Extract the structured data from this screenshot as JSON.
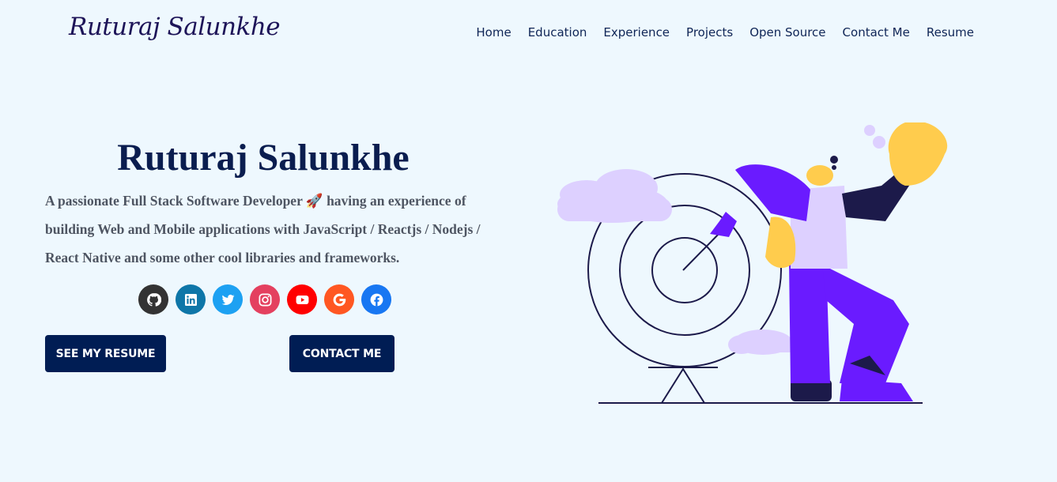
{
  "header": {
    "logo_text": "Ruturaj Salunkhe",
    "nav": [
      "Home",
      "Education",
      "Experience",
      "Projects",
      "Open Source",
      "Contact Me",
      "Resume"
    ]
  },
  "hero": {
    "title": "Ruturaj Salunkhe",
    "description_part1": "A passionate Full Stack Software Developer ",
    "emoji": "🚀",
    "description_part2": " having an experience of building Web and Mobile applications with JavaScript / Reactjs / Nodejs / React Native and some other cool libraries and frameworks.",
    "socials": [
      {
        "name": "github-icon",
        "color": "#333333"
      },
      {
        "name": "linkedin-icon",
        "color": "#0e76a8"
      },
      {
        "name": "twitter-icon",
        "color": "#1da1f2"
      },
      {
        "name": "instagram-icon",
        "color": "#e4405f"
      },
      {
        "name": "youtube-icon",
        "color": "#ff0000"
      },
      {
        "name": "google-icon",
        "color": "#ff5722"
      },
      {
        "name": "facebook-icon",
        "color": "#1877f2"
      }
    ],
    "buttons": {
      "resume": "SEE MY RESUME",
      "contact": "CONTACT ME"
    }
  },
  "colors": {
    "background": "#eef8fe",
    "primary": "#001d54",
    "accent_purple": "#6a1bff",
    "cloud": "#ddd0ff",
    "skin": "#ffcc4d"
  }
}
